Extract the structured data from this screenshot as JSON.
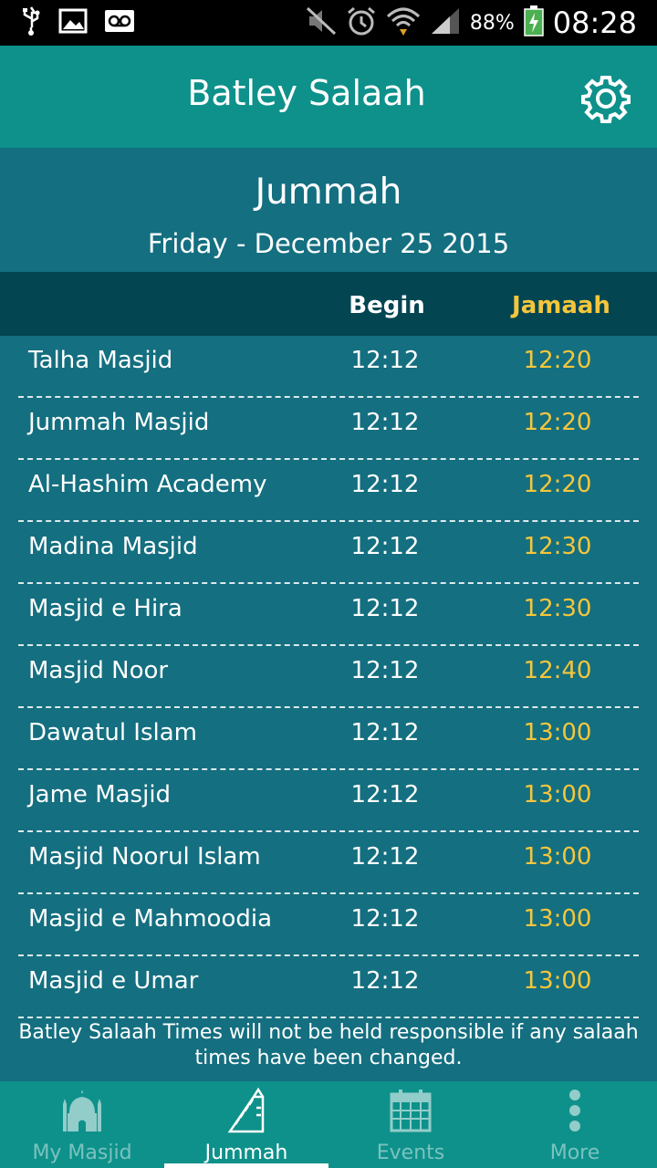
{
  "status_bar": {
    "battery": "88%",
    "time": "08:28"
  },
  "app": {
    "title": "Batley Salaah"
  },
  "page": {
    "title": "Jummah",
    "date": "Friday - December 25 2015"
  },
  "table": {
    "headers": {
      "begin": "Begin",
      "jamaah": "Jamaah"
    },
    "rows": [
      {
        "name": "Talha Masjid",
        "begin": "12:12",
        "jamaah": "12:20"
      },
      {
        "name": "Jummah Masjid",
        "begin": "12:12",
        "jamaah": "12:20"
      },
      {
        "name": "Al-Hashim Academy",
        "begin": "12:12",
        "jamaah": "12:20"
      },
      {
        "name": "Madina Masjid",
        "begin": "12:12",
        "jamaah": "12:30"
      },
      {
        "name": "Masjid e Hira",
        "begin": "12:12",
        "jamaah": "12:30"
      },
      {
        "name": "Masjid Noor",
        "begin": "12:12",
        "jamaah": "12:40"
      },
      {
        "name": "Dawatul Islam",
        "begin": "12:12",
        "jamaah": "13:00"
      },
      {
        "name": "Jame Masjid",
        "begin": "12:12",
        "jamaah": "13:00"
      },
      {
        "name": "Masjid Noorul Islam",
        "begin": "12:12",
        "jamaah": "13:00"
      },
      {
        "name": "Masjid e Mahmoodia",
        "begin": "12:12",
        "jamaah": "13:00"
      },
      {
        "name": "Masjid e Umar",
        "begin": "12:12",
        "jamaah": "13:00"
      }
    ]
  },
  "disclaimer": "Batley Salaah Times will not be held responsible if any salaah times have been changed.",
  "nav": {
    "items": [
      {
        "label": "My Masjid",
        "icon": "mosque-icon",
        "active": false
      },
      {
        "label": "Jummah",
        "icon": "minbar-icon",
        "active": true
      },
      {
        "label": "Events",
        "icon": "calendar-icon",
        "active": false
      },
      {
        "label": "More",
        "icon": "more-vertical-icon",
        "active": false
      }
    ]
  },
  "colors": {
    "header": "#0e918b",
    "background": "#146f80",
    "table_header": "#044552",
    "accent": "#f5c63c"
  }
}
